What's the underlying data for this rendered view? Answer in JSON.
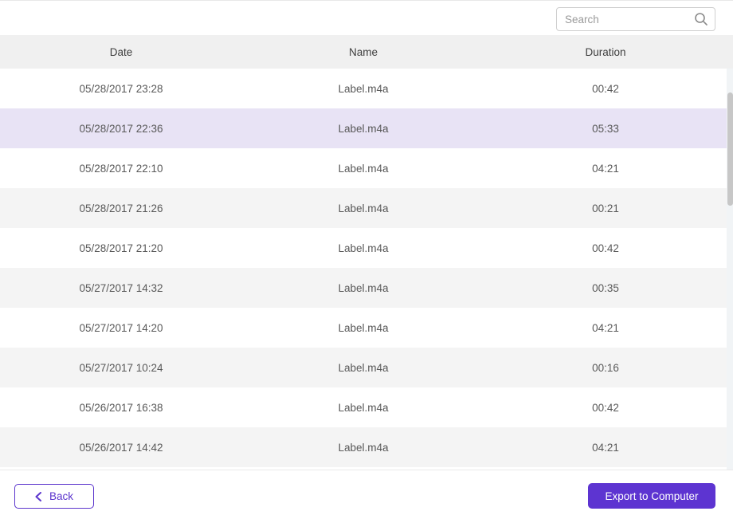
{
  "topbar": {
    "search": {
      "placeholder": "Search"
    }
  },
  "table": {
    "columns": [
      "Date",
      "Name",
      "Duration"
    ],
    "rows": [
      {
        "date": "05/28/2017 23:28",
        "name": "Label.m4a",
        "duration": "00:42",
        "selected": false
      },
      {
        "date": "05/28/2017 22:36",
        "name": "Label.m4a",
        "duration": "05:33",
        "selected": true
      },
      {
        "date": "05/28/2017 22:10",
        "name": "Label.m4a",
        "duration": "04:21",
        "selected": false
      },
      {
        "date": "05/28/2017 21:26",
        "name": "Label.m4a",
        "duration": "00:21",
        "selected": false
      },
      {
        "date": "05/28/2017 21:20",
        "name": "Label.m4a",
        "duration": "00:42",
        "selected": false
      },
      {
        "date": "05/27/2017 14:32",
        "name": "Label.m4a",
        "duration": "00:35",
        "selected": false
      },
      {
        "date": "05/27/2017 14:20",
        "name": "Label.m4a",
        "duration": "04:21",
        "selected": false
      },
      {
        "date": "05/27/2017 10:24",
        "name": "Label.m4a",
        "duration": "00:16",
        "selected": false
      },
      {
        "date": "05/26/2017 16:38",
        "name": "Label.m4a",
        "duration": "00:42",
        "selected": false
      },
      {
        "date": "05/26/2017 14:42",
        "name": "Label.m4a",
        "duration": "04:21",
        "selected": false
      }
    ]
  },
  "footer": {
    "back_label": "Back",
    "export_label": "Export to Computer"
  },
  "colors": {
    "accent_purple": "#5c35cd",
    "export_button_bg": "#5d34d1",
    "selected_row_bg": "#e8e3f5",
    "stripe_row_bg": "#f4f4f4",
    "header_bg": "#f0f0f0",
    "scrollbar_thumb": "#c7c7c7"
  }
}
